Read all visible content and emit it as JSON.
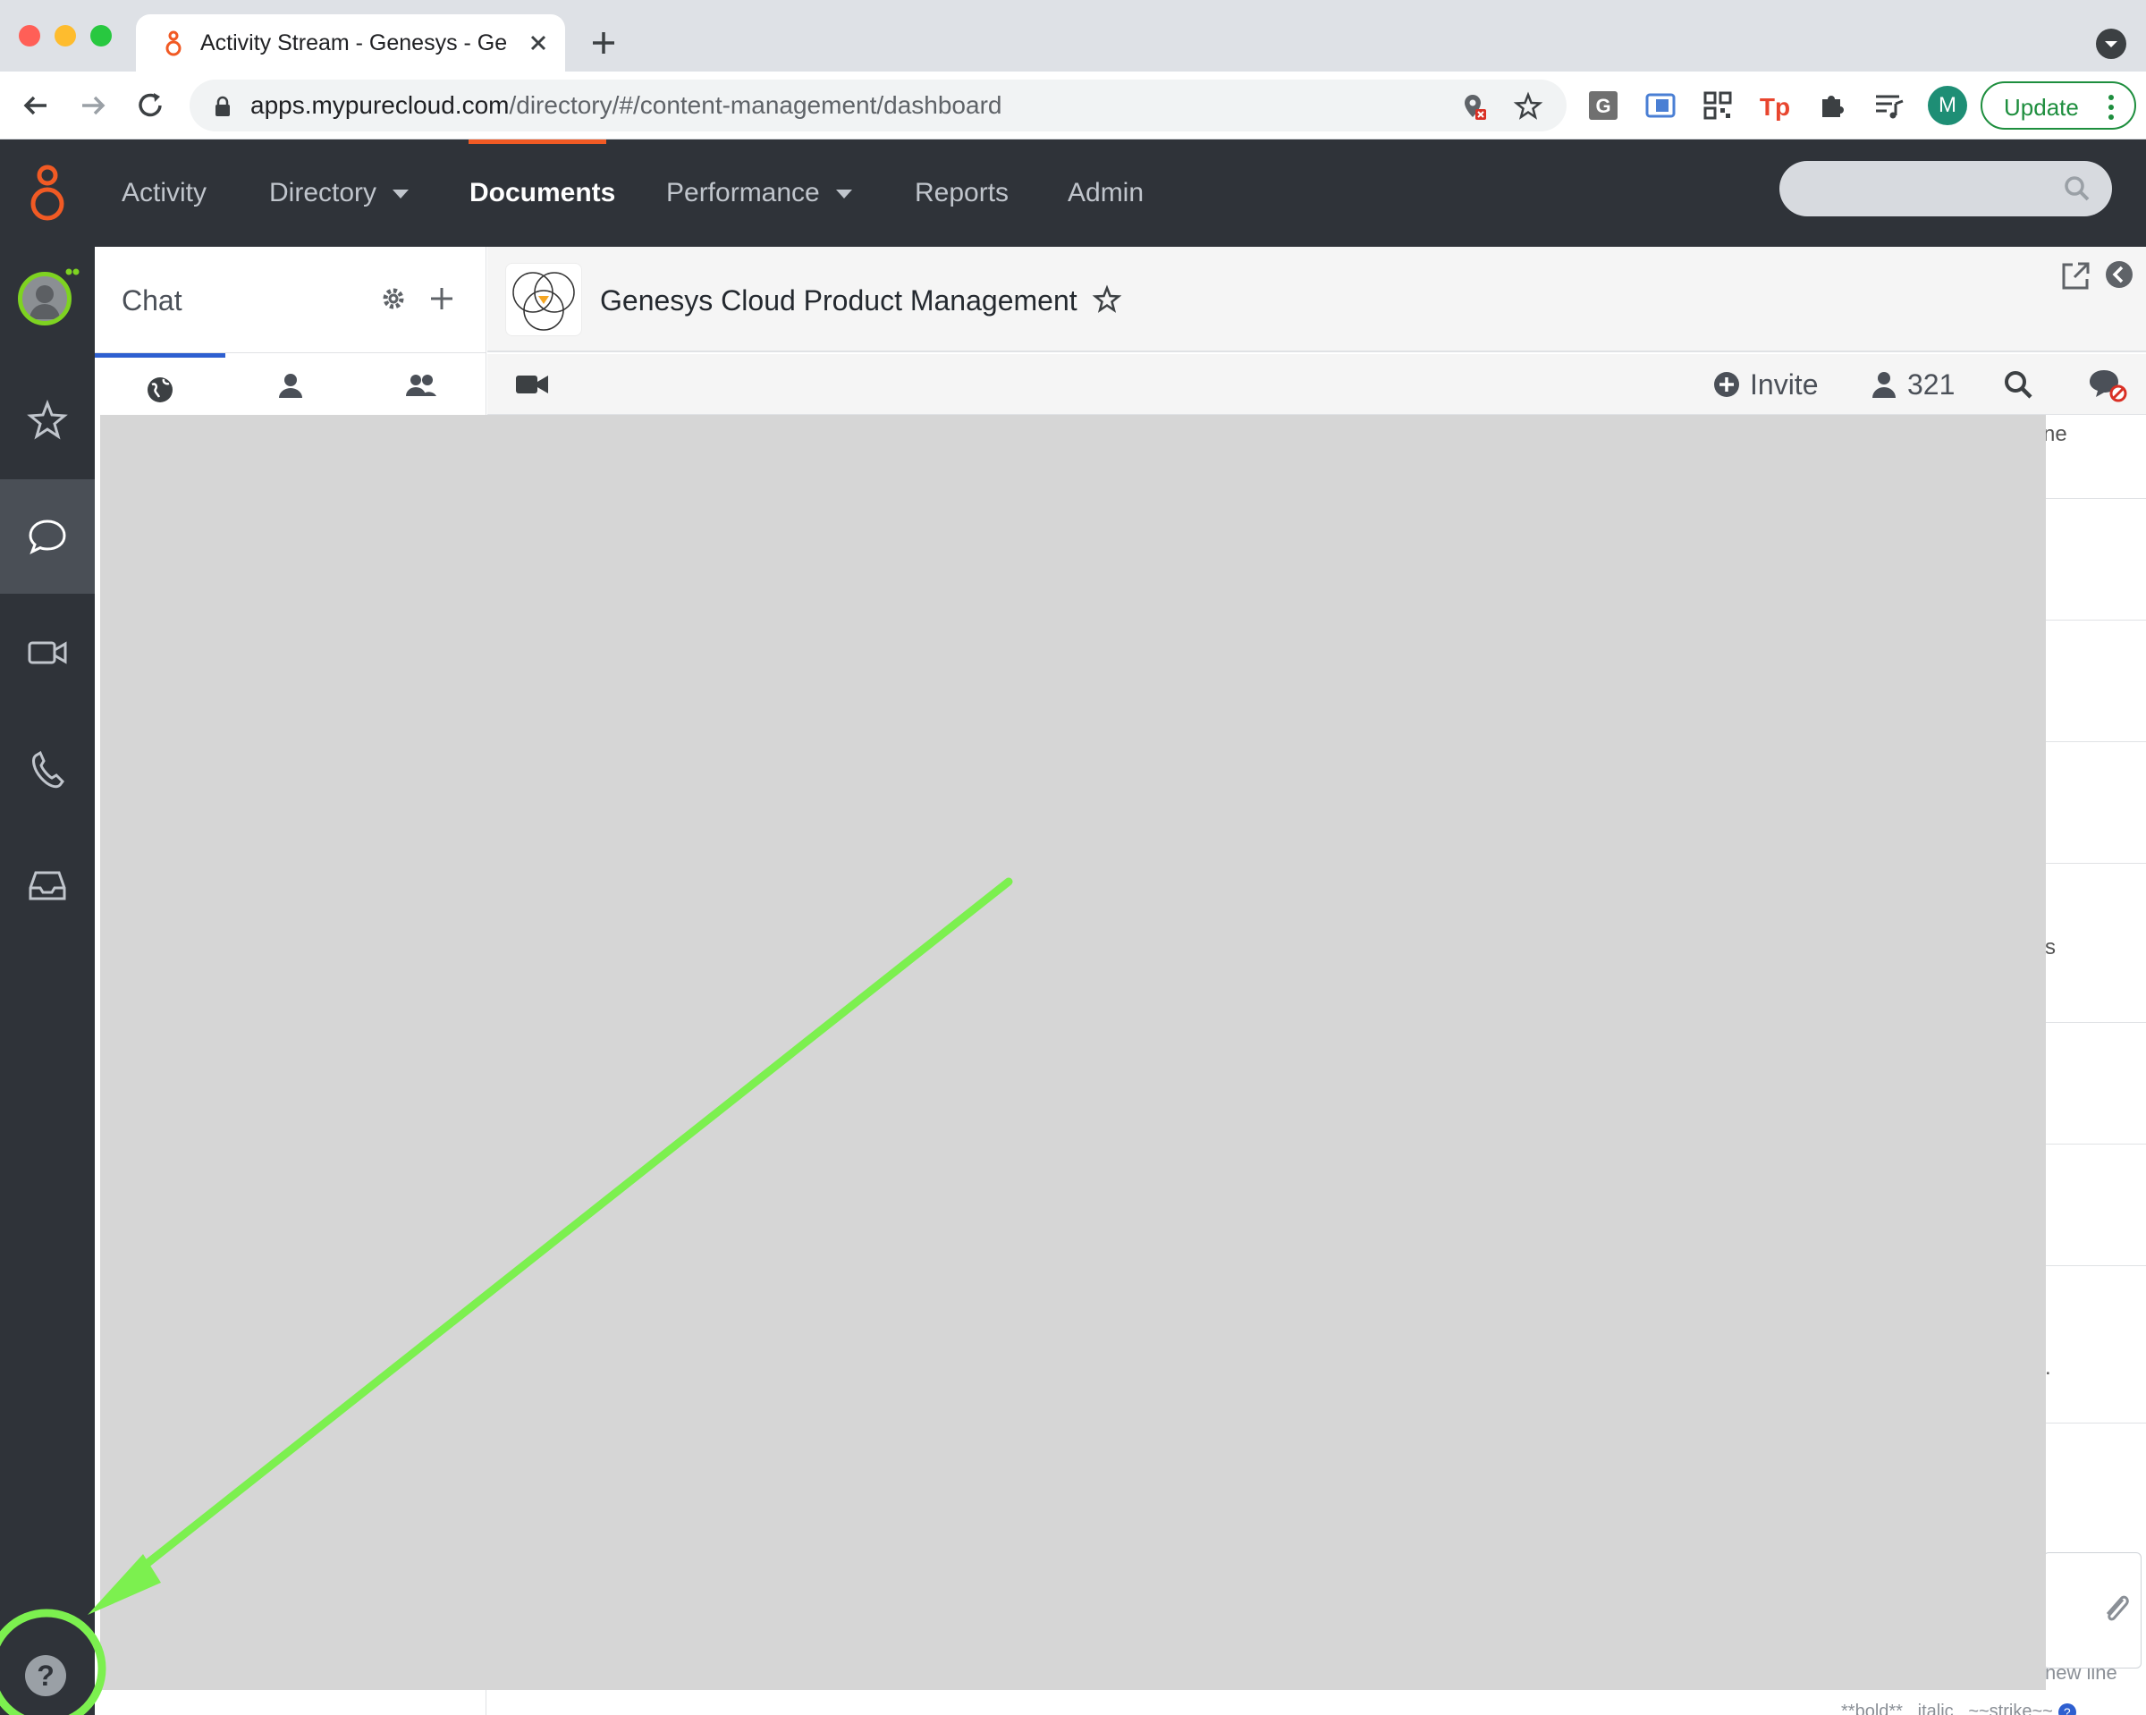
{
  "browser": {
    "tab_title": "Activity Stream - Genesys - Ge",
    "url_host": "apps.mypurecloud.com",
    "url_path": "/directory/#/content-management/dashboard",
    "profile_initial": "M",
    "update_label": "Update"
  },
  "topnav": {
    "items": [
      {
        "label": "Activity"
      },
      {
        "label": "Directory"
      },
      {
        "label": "Documents"
      },
      {
        "label": "Performance"
      },
      {
        "label": "Reports"
      },
      {
        "label": "Admin"
      }
    ],
    "active": "Documents"
  },
  "chat": {
    "title": "Chat"
  },
  "room": {
    "title": "Genesys Cloud Product Management",
    "invite_label": "Invite",
    "member_count": "321"
  },
  "stubs": {
    "top": "ne",
    "mid": "s",
    "low": ".",
    "newline": "new line",
    "format_hint": "**bold** _italic_ ~~strike~~",
    "help_icon_glyph": "?"
  },
  "colors": {
    "accent": "#f15a24",
    "nav_bg": "#2f3339",
    "annotation": "#7cf04f",
    "selected_tab": "#2e5fd0"
  }
}
